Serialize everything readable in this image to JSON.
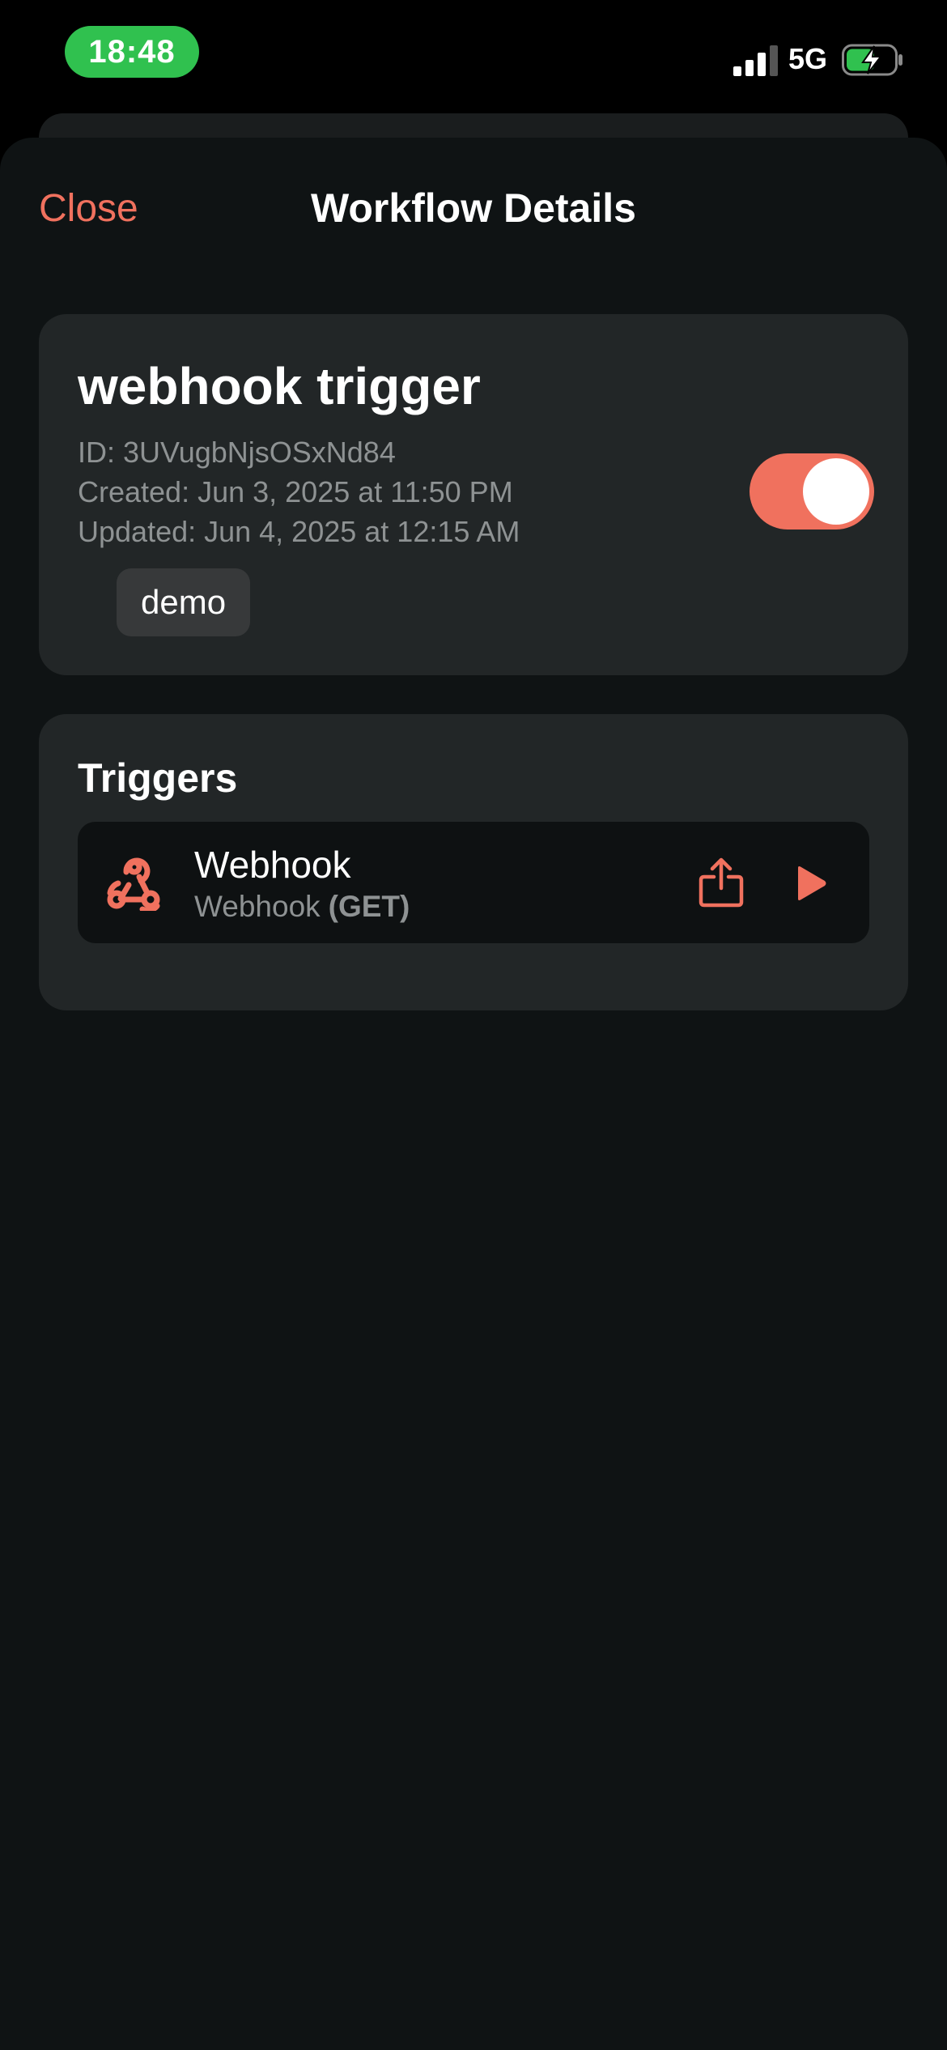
{
  "status_bar": {
    "time": "18:48",
    "network": "5G",
    "signal_icon": "signal-bars-icon",
    "battery_icon": "battery-charging-icon"
  },
  "nav": {
    "close_label": "Close",
    "title": "Workflow Details"
  },
  "workflow": {
    "name": "webhook trigger",
    "id_text": "ID: 3UVugbNjsOSxNd84",
    "created_text": "Created: Jun 3, 2025 at 11:50 PM",
    "updated_text": "Updated: Jun 4, 2025 at 12:15 AM",
    "tag": "demo",
    "active": true
  },
  "triggers": {
    "section_title": "Triggers",
    "items": [
      {
        "title": "Webhook",
        "subtitle": "Webhook",
        "method": "(GET)",
        "icon": "webhook-icon"
      }
    ]
  },
  "colors": {
    "accent": "#f0715e",
    "status_pill": "#30c14f",
    "sheet_background": "#0f1314",
    "card_background": "#222627",
    "row_background": "#0e1112",
    "secondary_text": "#8e9293"
  }
}
